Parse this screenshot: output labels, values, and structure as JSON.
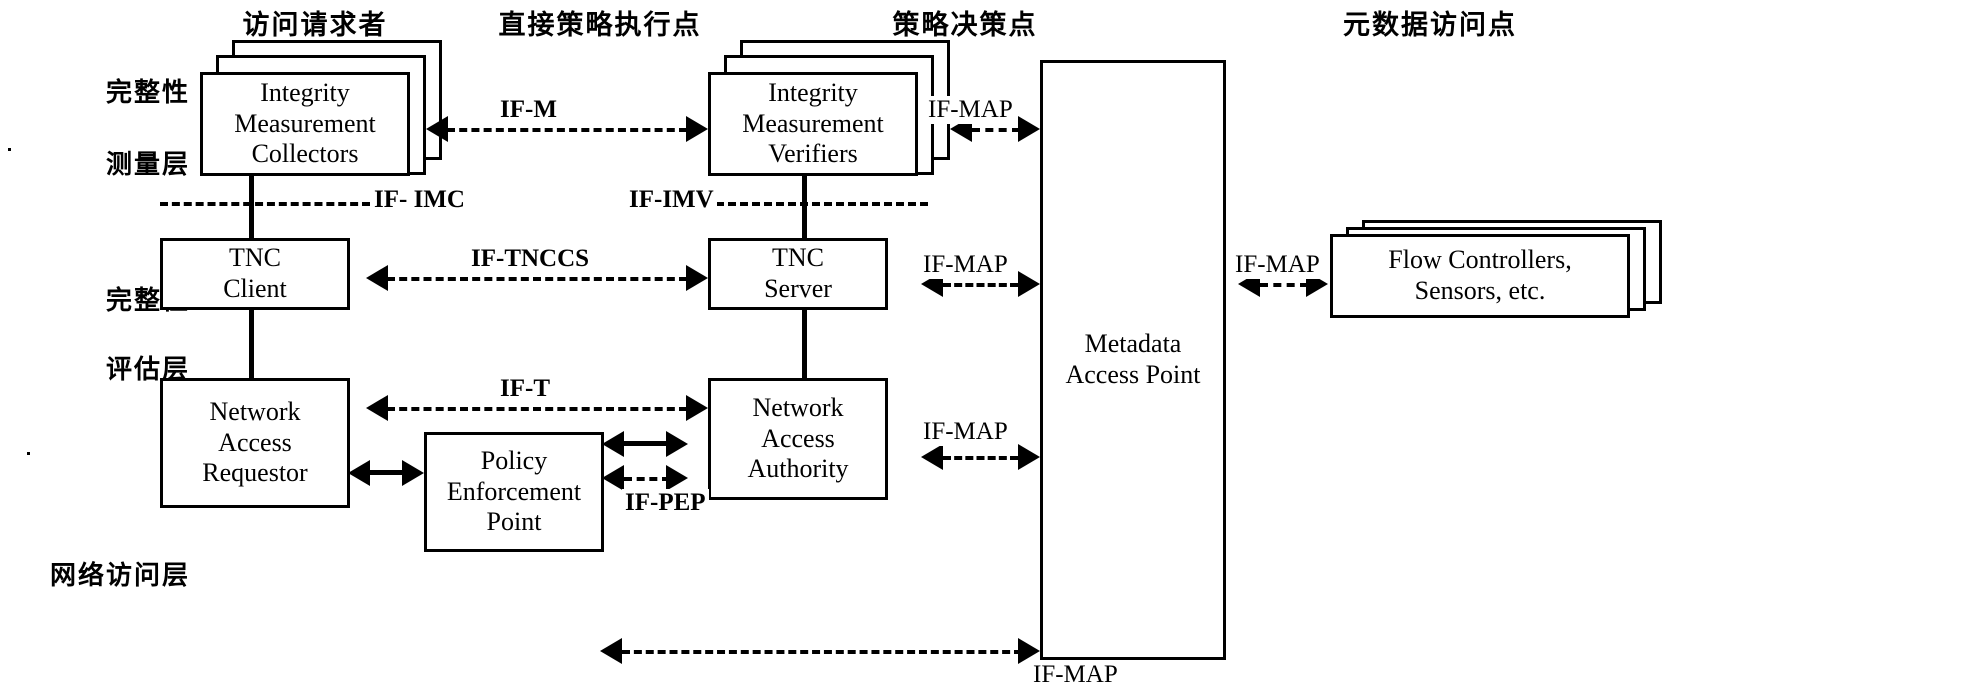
{
  "diagram": {
    "title_columns": [
      {
        "id": "access-requestor",
        "label": "访问请求者"
      },
      {
        "id": "policy-enforcement-point",
        "label": "直接策略执行点"
      },
      {
        "id": "policy-decision-point",
        "label": "策略决策点"
      },
      {
        "id": "metadata-access-point",
        "label": "元数据访问点"
      }
    ],
    "layer_labels": [
      {
        "id": "integrity-measurement-layer",
        "lines": [
          "完整性",
          "测量层"
        ]
      },
      {
        "id": "integrity-evaluation-layer",
        "lines": [
          "完整性",
          "评估层"
        ]
      },
      {
        "id": "network-access-layer",
        "lines": [
          "网络访问层"
        ]
      }
    ],
    "boxes": [
      {
        "id": "integrity-measurement-collectors",
        "lines": [
          "Integrity",
          "Measurement",
          "Collectors"
        ],
        "stacked": true
      },
      {
        "id": "integrity-measurement-verifiers",
        "lines": [
          "Integrity",
          "Measurement",
          "Verifiers"
        ],
        "stacked": true
      },
      {
        "id": "tnc-client",
        "lines": [
          "TNC",
          "Client"
        ],
        "stacked": false
      },
      {
        "id": "tnc-server",
        "lines": [
          "TNC",
          "Server"
        ],
        "stacked": false
      },
      {
        "id": "network-access-requestor",
        "lines": [
          "Network",
          "Access",
          "Requestor"
        ],
        "stacked": false
      },
      {
        "id": "policy-enforcement-point",
        "lines": [
          "Policy",
          "Enforcement",
          "Point"
        ],
        "stacked": false
      },
      {
        "id": "network-access-authority",
        "lines": [
          "Network",
          "Access",
          "Authority"
        ],
        "stacked": false
      },
      {
        "id": "metadata-access-point",
        "lines": [
          "Metadata",
          "Access Point"
        ],
        "stacked": false
      },
      {
        "id": "flow-controllers",
        "lines": [
          "Flow Controllers,",
          "Sensors, etc."
        ],
        "stacked": true
      }
    ],
    "interfaces": [
      {
        "id": "if-m",
        "label": "IF-M",
        "bold": true,
        "from": "integrity-measurement-collectors",
        "to": "integrity-measurement-verifiers",
        "style": "dashed",
        "direction": "both"
      },
      {
        "id": "if-map-imv",
        "label": "IF-MAP",
        "bold": false,
        "from": "integrity-measurement-verifiers",
        "to": "metadata-access-point",
        "style": "dashed",
        "direction": "both"
      },
      {
        "id": "if-imc",
        "label": "IF- IMC",
        "bold": true,
        "from": "integrity-measurement-collectors",
        "to": "tnc-client",
        "style": "dashed",
        "direction": "none"
      },
      {
        "id": "if-imv",
        "label": "IF-IMV",
        "bold": true,
        "from": "integrity-measurement-verifiers",
        "to": "tnc-server",
        "style": "dashed",
        "direction": "none"
      },
      {
        "id": "if-tnccs",
        "label": "IF-TNCCS",
        "bold": true,
        "from": "tnc-client",
        "to": "tnc-server",
        "style": "dashed",
        "direction": "both"
      },
      {
        "id": "if-map-tncs",
        "label": "IF-MAP",
        "bold": false,
        "from": "tnc-server",
        "to": "metadata-access-point",
        "style": "dashed",
        "direction": "both"
      },
      {
        "id": "if-map-flow",
        "label": "IF-MAP",
        "bold": false,
        "from": "metadata-access-point",
        "to": "flow-controllers",
        "style": "dashed",
        "direction": "both"
      },
      {
        "id": "if-t",
        "label": "IF-T",
        "bold": true,
        "from": "network-access-requestor",
        "to": "network-access-authority",
        "style": "dashed",
        "direction": "both"
      },
      {
        "id": "if-pep",
        "label": "IF-PEP",
        "bold": true,
        "from": "policy-enforcement-point",
        "to": "network-access-authority",
        "style": "dashed",
        "direction": "both"
      },
      {
        "id": "if-map-naa",
        "label": "IF-MAP",
        "bold": false,
        "from": "network-access-authority",
        "to": "metadata-access-point",
        "style": "dashed",
        "direction": "both"
      },
      {
        "id": "if-map-pep",
        "label": "IF-MAP",
        "bold": false,
        "from": "policy-enforcement-point",
        "to": "metadata-access-point",
        "style": "dashed",
        "direction": "left"
      }
    ],
    "colors": {
      "ink": "#000000",
      "paper": "#ffffff"
    }
  }
}
